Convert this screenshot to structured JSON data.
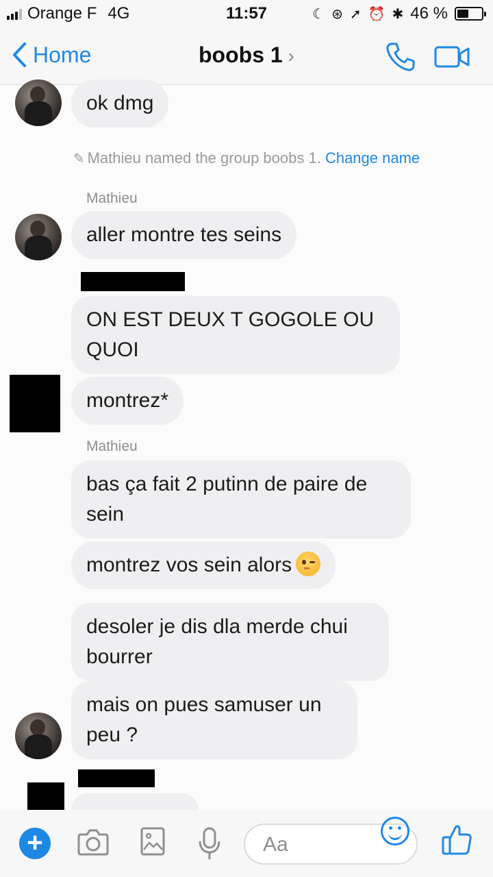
{
  "status_bar": {
    "carrier": "Orange F",
    "network": "4G",
    "time": "11:57",
    "battery_percent": "46 %",
    "battery_level": 0.46,
    "icons": [
      "moon-icon",
      "lock-rotation-icon",
      "location-icon",
      "alarm-icon",
      "bluetooth-icon"
    ]
  },
  "nav": {
    "back_label": "Home",
    "title": "boobs 1",
    "title_chevron": "›",
    "icons": [
      "back-chevron-icon",
      "phone-icon",
      "video-camera-icon"
    ]
  },
  "system_message": {
    "text": "Mathieu named the group boobs 1.",
    "link": "Change name"
  },
  "messages": [
    {
      "sender": "",
      "text": "ok dmg"
    },
    {
      "sender": "Mathieu",
      "text": "aller montre tes seins"
    },
    {
      "sender": "",
      "text": "ON EST DEUX T GOGOLE OU QUOI"
    },
    {
      "sender": "",
      "text": "montrez*"
    },
    {
      "sender": "Mathieu",
      "text": "bas ça fait 2 putinn de paire de sein"
    },
    {
      "sender": "",
      "text": "montrez vos sein alors",
      "emoji": "winking-face"
    },
    {
      "sender": "",
      "text": "desoler je dis dla merde chui bourrer"
    },
    {
      "sender": "",
      "text": "mais on pues samuser un peu ?"
    }
  ],
  "composer": {
    "placeholder": "Aa",
    "icons": [
      "plus-icon",
      "camera-icon",
      "image-icon",
      "microphone-icon",
      "emoji-icon",
      "thumbs-up-icon"
    ]
  },
  "colors": {
    "accent": "#1e88e5",
    "bubble": "#efeff1",
    "redaction": "#000000"
  }
}
